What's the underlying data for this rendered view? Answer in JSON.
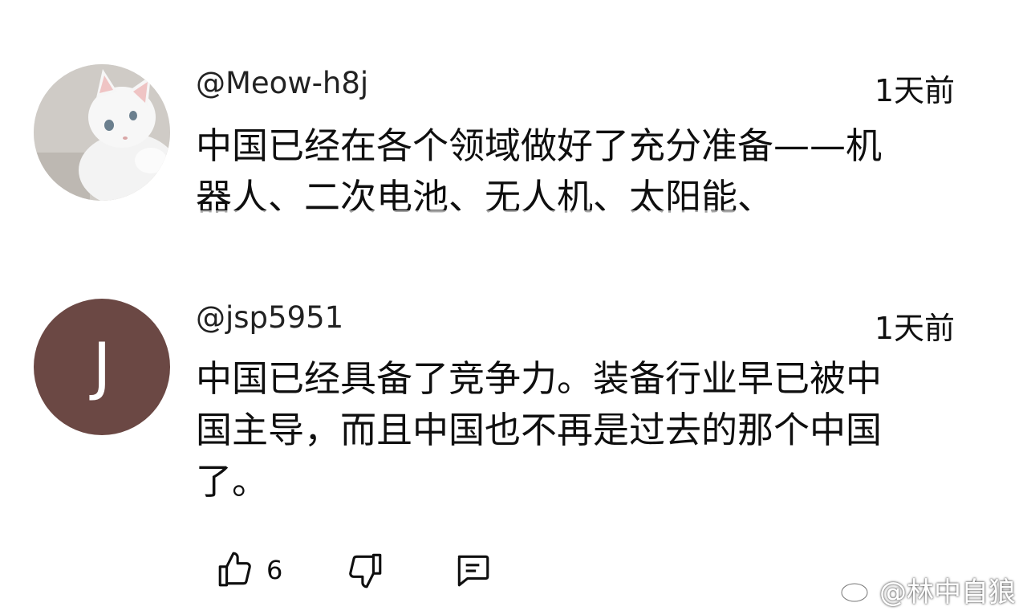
{
  "comments": [
    {
      "handle": "@Meow-h8j",
      "time": "1天前",
      "text": "中国已经在各个领域做好了充分准备——机\n器人、二次电池、无人机、太阳能、",
      "avatar_icon": "cat-photo-avatar"
    },
    {
      "handle": "@jsp5951",
      "time": "1天前",
      "text": "中国已经具备了竞争力。装备行业早已被中\n国主导，而且中国也不再是过去的那个中国\n了。",
      "avatar_letter": "J",
      "avatar_color": "#6b4844"
    }
  ],
  "actions": {
    "like_count": "6",
    "like_icon": "thumbs-up-icon",
    "dislike_icon": "thumbs-down-icon",
    "reply_icon": "comment-icon"
  },
  "watermark": {
    "text": "@林中自狼",
    "icon": "weibo-logo-icon"
  }
}
